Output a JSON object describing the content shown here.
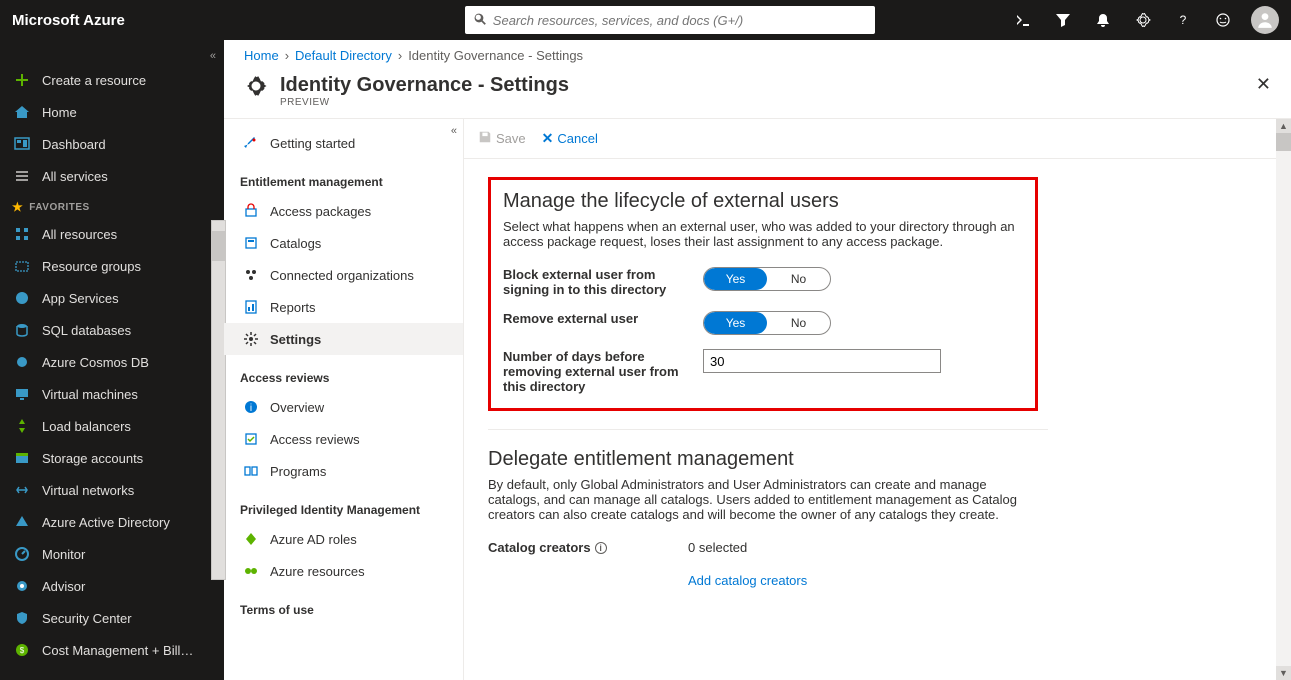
{
  "topbar": {
    "brand": "Microsoft Azure",
    "search_placeholder": "Search resources, services, and docs (G+/)"
  },
  "leftnav": {
    "items": [
      {
        "label": "Create a resource",
        "icon": "plus"
      },
      {
        "label": "Home",
        "icon": "home"
      },
      {
        "label": "Dashboard",
        "icon": "dashboard"
      },
      {
        "label": "All services",
        "icon": "list"
      }
    ],
    "group_label": "FAVORITES",
    "favorites": [
      {
        "label": "All resources",
        "icon": "grid"
      },
      {
        "label": "Resource groups",
        "icon": "resourcegroup"
      },
      {
        "label": "App Services",
        "icon": "appservice"
      },
      {
        "label": "SQL databases",
        "icon": "sql"
      },
      {
        "label": "Azure Cosmos DB",
        "icon": "cosmos"
      },
      {
        "label": "Virtual machines",
        "icon": "vm"
      },
      {
        "label": "Load balancers",
        "icon": "lb"
      },
      {
        "label": "Storage accounts",
        "icon": "storage"
      },
      {
        "label": "Virtual networks",
        "icon": "vnet"
      },
      {
        "label": "Azure Active Directory",
        "icon": "aad"
      },
      {
        "label": "Monitor",
        "icon": "monitor"
      },
      {
        "label": "Advisor",
        "icon": "advisor"
      },
      {
        "label": "Security Center",
        "icon": "security"
      },
      {
        "label": "Cost Management + Bill…",
        "icon": "cost"
      }
    ]
  },
  "breadcrumb": {
    "home": "Home",
    "dir": "Default Directory",
    "current": "Identity Governance - Settings"
  },
  "blade": {
    "title": "Identity Governance - Settings",
    "preview": "PREVIEW"
  },
  "innernav": {
    "getting_started": "Getting started",
    "group_em": "Entitlement management",
    "em": [
      "Access packages",
      "Catalogs",
      "Connected organizations",
      "Reports",
      "Settings"
    ],
    "group_ar": "Access reviews",
    "ar": [
      "Overview",
      "Access reviews",
      "Programs"
    ],
    "group_pim": "Privileged Identity Management",
    "pim": [
      "Azure AD roles",
      "Azure resources"
    ],
    "group_tou": "Terms of use"
  },
  "cmdbar": {
    "save": "Save",
    "cancel": "Cancel"
  },
  "content": {
    "sec1_title": "Manage the lifecycle of external users",
    "sec1_desc": "Select what happens when an external user, who was added to your directory through an access package request, loses their last assignment to any access package.",
    "block_label": "Block external user from signing in to this directory",
    "remove_label": "Remove external user",
    "days_label": "Number of days before removing external user from this directory",
    "days_value": "30",
    "yes": "Yes",
    "no": "No",
    "sec2_title": "Delegate entitlement management",
    "sec2_desc": "By default, only Global Administrators and User Administrators can create and manage catalogs, and can manage all catalogs. Users added to entitlement management as Catalog creators can also create catalogs and will become the owner of any catalogs they create.",
    "catalog_creators": "Catalog creators",
    "selected": "0 selected",
    "add_link": "Add catalog creators"
  }
}
